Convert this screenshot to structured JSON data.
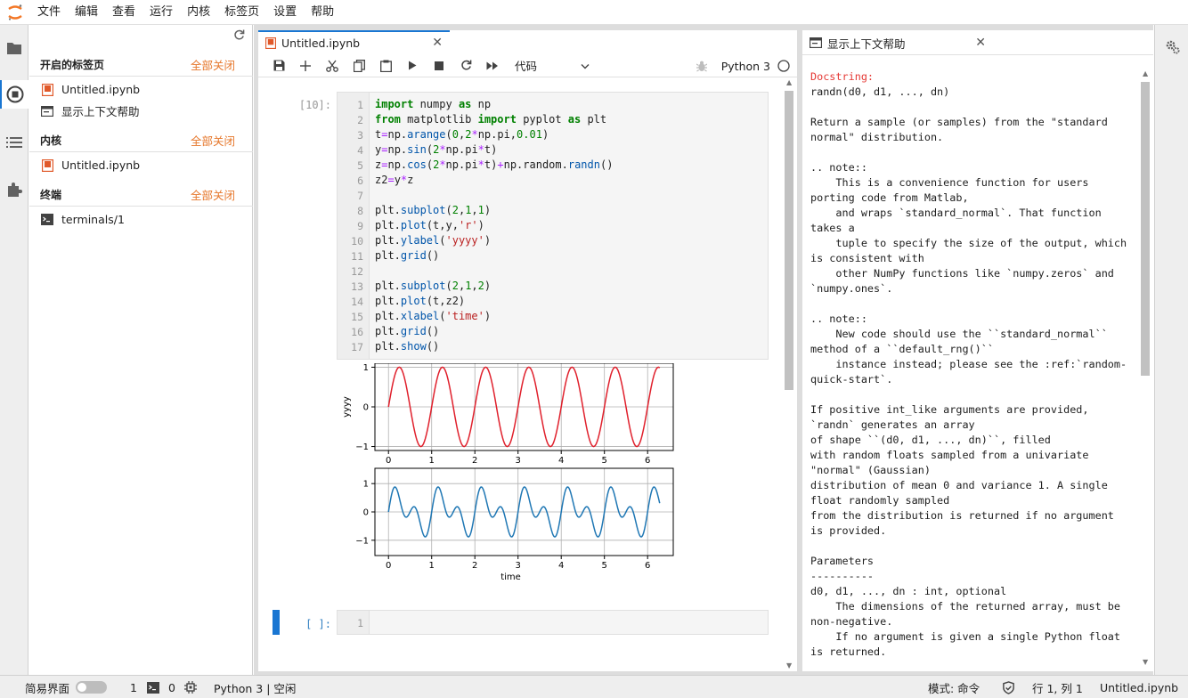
{
  "menu": [
    "文件",
    "编辑",
    "查看",
    "运行",
    "内核",
    "标签页",
    "设置",
    "帮助"
  ],
  "left_panel": {
    "open_tabs_title": "开启的标签页",
    "close_all": "全部关闭",
    "open_tabs": [
      "Untitled.ipynb",
      "显示上下文帮助"
    ],
    "kernels_title": "内核",
    "kernels": [
      "Untitled.ipynb"
    ],
    "terminals_title": "终端",
    "terminals": [
      "terminals/1"
    ]
  },
  "notebook": {
    "tab_title": "Untitled.ipynb",
    "cell_type": "代码",
    "kernel_name": "Python 3",
    "cell1_prompt": "[10]:",
    "cell2_prompt": "[ ]:",
    "cell2_line": "1",
    "code_lines": [
      "import numpy as np",
      "from matplotlib import pyplot as plt",
      "t=np.arange(0,2*np.pi,0.01)",
      "y=np.sin(2*np.pi*t)",
      "z=np.cos(2*np.pi*t)+np.random.randn()",
      "z2=y*z",
      "",
      "plt.subplot(2,1,1)",
      "plt.plot(t,y,'r')",
      "plt.ylabel('yyyy')",
      "plt.grid()",
      "",
      "plt.subplot(2,1,2)",
      "plt.plot(t,z2)",
      "plt.xlabel('time')",
      "plt.grid()",
      "plt.show()"
    ]
  },
  "chart_data": [
    {
      "type": "line",
      "function": "sin(2*pi*t)",
      "x_range": [
        0,
        6.28
      ],
      "step": 0.01,
      "ylabel": "yyyy",
      "xlabel": "",
      "xticks": [
        "0",
        "1",
        "2",
        "3",
        "4",
        "5",
        "6"
      ],
      "yticks": [
        "1",
        "0",
        "−1"
      ],
      "ylim": [
        -1,
        1
      ],
      "color": "#e0202c",
      "grid": true
    },
    {
      "type": "line",
      "function": "sin(2*pi*t)*(cos(2*pi*t)+0.5)",
      "x_range": [
        0,
        6.28
      ],
      "step": 0.01,
      "ylabel": "",
      "xlabel": "time",
      "xticks": [
        "0",
        "1",
        "2",
        "3",
        "4",
        "5",
        "6"
      ],
      "yticks": [
        "1",
        "0",
        "−1"
      ],
      "ylim": [
        -1.4,
        1.4
      ],
      "color": "#1f77b4",
      "grid": true
    }
  ],
  "help": {
    "tab_title": "显示上下文帮助",
    "doc_head": "Docstring:",
    "doc_body": "randn(d0, d1, ..., dn)\n\nReturn a sample (or samples) from the \"standard\nnormal\" distribution.\n\n.. note::\n    This is a convenience function for users\nporting code from Matlab,\n    and wraps `standard_normal`. That function\ntakes a\n    tuple to specify the size of the output, which\nis consistent with\n    other NumPy functions like `numpy.zeros` and\n`numpy.ones`.\n\n.. note::\n    New code should use the ``standard_normal``\nmethod of a ``default_rng()``\n    instance instead; please see the :ref:`random-\nquick-start`.\n\nIf positive int_like arguments are provided,\n`randn` generates an array\nof shape ``(d0, d1, ..., dn)``, filled\nwith random floats sampled from a univariate\n\"normal\" (Gaussian)\ndistribution of mean 0 and variance 1. A single\nfloat randomly sampled\nfrom the distribution is returned if no argument\nis provided.\n\nParameters\n----------\nd0, d1, ..., dn : int, optional\n    The dimensions of the returned array, must be\nnon-negative.\n    If no argument is given a single Python float\nis returned."
  },
  "status": {
    "simple_mode": "简易界面",
    "terminals_count": "1",
    "kernels_count": "0",
    "kernel_status": "Python 3 | 空闲",
    "mode": "模式: 命令",
    "cursor": "行 1, 列 1",
    "file": "Untitled.ipynb"
  }
}
